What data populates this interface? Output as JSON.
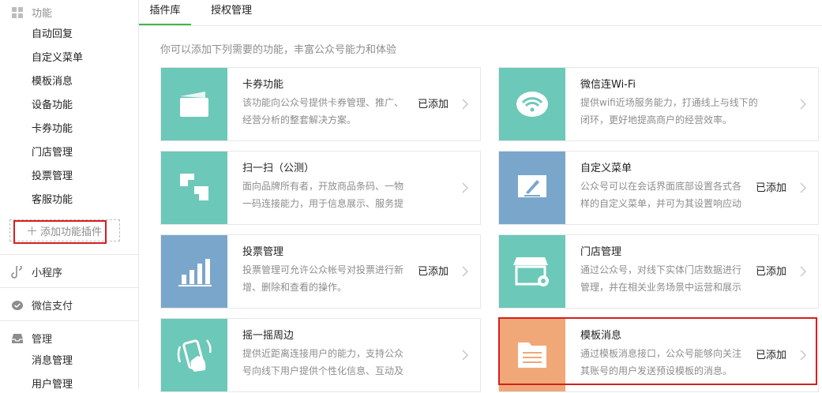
{
  "sidebar": {
    "function_label": "功能",
    "function_items": [
      "自动回复",
      "自定义菜单",
      "模板消息",
      "设备功能",
      "卡券功能",
      "门店管理",
      "投票管理",
      "客服功能"
    ],
    "add_plugin_label": "添加功能插件",
    "miniprogram_label": "小程序",
    "pay_label": "微信支付",
    "manage_label": "管理",
    "manage_items": [
      "消息管理",
      "用户管理"
    ]
  },
  "tabs": [
    "插件库",
    "授权管理"
  ],
  "intro": "你可以添加下列需要的功能，丰富公众号能力和体验",
  "cards": [
    {
      "title": "卡券功能",
      "desc": "该功能向公众号提供卡券管理、推广、经营分析的整套解决方案。",
      "status": "已添加",
      "color": "#6cc8b8",
      "icon": "card-icon"
    },
    {
      "title": "微信连Wi-Fi",
      "desc": "提供wifi近场服务能力，打通线上与线下的闭环，更好地提高商户的经营效率。",
      "status": "",
      "color": "#6cc8b8",
      "icon": "wifi-icon"
    },
    {
      "title": "扫一扫（公测）",
      "desc": "面向品牌所有者，开放商品条码、一物一码连接能力，用于信息展示、服务提供",
      "status": "",
      "color": "#6cc8b8",
      "icon": "scan-icon"
    },
    {
      "title": "自定义菜单",
      "desc": "公众号可以在会话界面底部设置各式各样的自定义菜单，并可为其设置响应动作",
      "status": "已添加",
      "color": "#7aa6cb",
      "icon": "edit-icon"
    },
    {
      "title": "投票管理",
      "desc": "投票管理可允许公众帐号对投票进行新增、删除和查看的操作。",
      "status": "已添加",
      "color": "#7aa6cb",
      "icon": "bar-chart-icon"
    },
    {
      "title": "门店管理",
      "desc": "通过公众号，对线下实体门店数据进行管理，并在相关业务场景中运营和展示",
      "status": "已添加",
      "color": "#6cc8b8",
      "icon": "store-icon"
    },
    {
      "title": "摇一摇周边",
      "desc": "提供近距离连接用户的能力，支持公众号向线下用户提供个性化信息、互动及服务",
      "status": "",
      "color": "#6cc8b8",
      "icon": "shake-icon"
    },
    {
      "title": "模板消息",
      "desc": "通过模板消息接口，公众号能够向关注其账号的用户发送预设模板的消息。",
      "status": "已添加",
      "color": "#f0a878",
      "icon": "document-icon"
    }
  ]
}
